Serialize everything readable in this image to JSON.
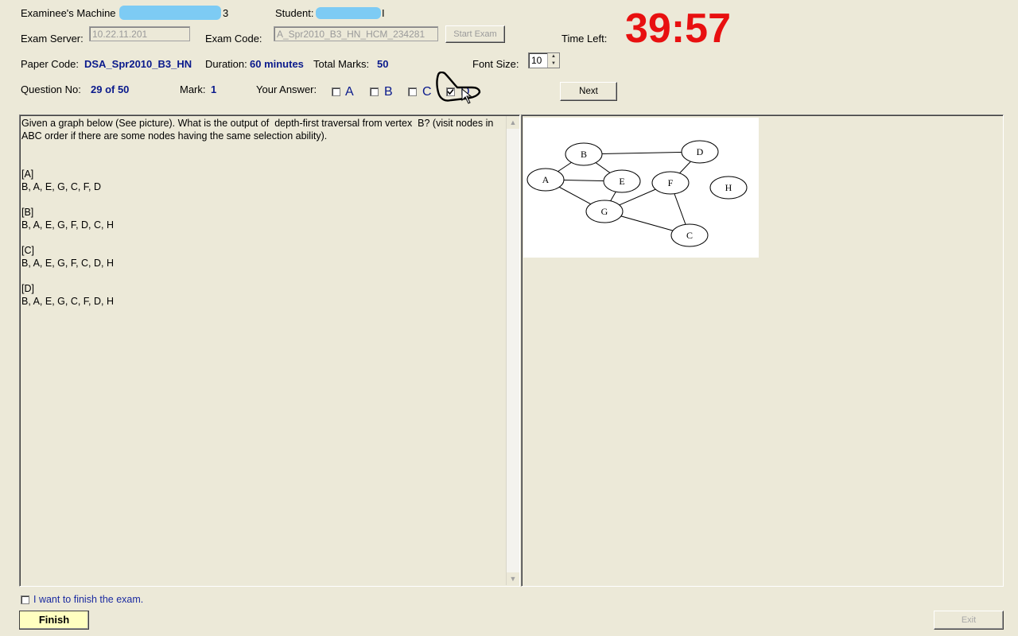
{
  "header": {
    "examinee_machine_label": "Examinee's Machine",
    "examinee_machine_suffix": "3",
    "student_label": "Student:",
    "student_suffix": "I",
    "exam_server_label": "Exam Server:",
    "exam_server_value": "10.22.11.201",
    "exam_code_label": "Exam Code:",
    "exam_code_value": "A_Spr2010_B3_HN_HCM_234281",
    "start_exam_label": "Start Exam",
    "time_left_label": "Time Left:",
    "time_left_value": "39:57",
    "paper_code_label": "Paper Code:",
    "paper_code_value": "DSA_Spr2010_B3_HN",
    "duration_label": "Duration:",
    "duration_value": "60 minutes",
    "total_marks_label": "Total Marks:",
    "total_marks_value": "50",
    "font_size_label": "Font Size:",
    "font_size_value": "10",
    "question_no_label": "Question No:",
    "question_no_value": "29 of 50",
    "mark_label": "Mark:",
    "mark_value": "1",
    "your_answer_label": "Your Answer:",
    "answer_options": [
      {
        "letter": "A",
        "checked": false
      },
      {
        "letter": "B",
        "checked": false
      },
      {
        "letter": "C",
        "checked": false
      },
      {
        "letter": "D",
        "checked": true
      }
    ],
    "next_label": "Next"
  },
  "question": {
    "stem": "Given a graph below (See picture). What is the output of  depth-first traversal from vertex  B? (visit nodes in ABC order if there are some nodes having the same selection ability).",
    "options": [
      {
        "tag": "[A]",
        "text": "B, A, E, G, C, F, D"
      },
      {
        "tag": "[B]",
        "text": "B, A, E, G, F, D, C, H"
      },
      {
        "tag": "[C]",
        "text": "B, A, E, G, F, C, D, H"
      },
      {
        "tag": "[D]",
        "text": "B, A, E, G, C, F, D, H"
      }
    ]
  },
  "graph": {
    "nodes": [
      "A",
      "B",
      "C",
      "D",
      "E",
      "F",
      "G",
      "H"
    ],
    "edges": [
      [
        "A",
        "B"
      ],
      [
        "A",
        "E"
      ],
      [
        "A",
        "G"
      ],
      [
        "B",
        "E"
      ],
      [
        "B",
        "D"
      ],
      [
        "E",
        "G"
      ],
      [
        "D",
        "F"
      ],
      [
        "F",
        "G"
      ],
      [
        "F",
        "C"
      ],
      [
        "G",
        "C"
      ]
    ]
  },
  "footer": {
    "finish_checkbox_label": "I want to finish the exam.",
    "finish_button_label": "Finish",
    "exit_button_label": "Exit"
  },
  "colors": {
    "background": "#ece9d8",
    "timer": "#e81010",
    "value_text": "#0a1a8c",
    "finish_button": "#ffffc0",
    "redaction": "#77c9f5"
  }
}
